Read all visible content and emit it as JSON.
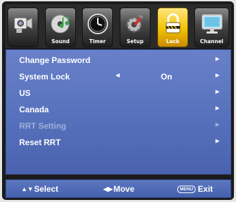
{
  "tabs": [
    {
      "label": "",
      "icon": "camcorder-icon",
      "active": false
    },
    {
      "label": "Sound",
      "icon": "music-cd-icon",
      "active": false
    },
    {
      "label": "Timer",
      "icon": "clock-icon",
      "active": false
    },
    {
      "label": "Setup",
      "icon": "gear-setup-icon",
      "active": false
    },
    {
      "label": "Lock",
      "icon": "padlock-icon",
      "active": true
    },
    {
      "label": "Channel",
      "icon": "monitor-icon",
      "active": false
    }
  ],
  "menu": {
    "items": [
      {
        "label": "Change Password",
        "value": "",
        "disabled": false
      },
      {
        "label": "System Lock",
        "value": "On",
        "disabled": false
      },
      {
        "label": "US",
        "value": "",
        "disabled": false
      },
      {
        "label": "Canada",
        "value": "",
        "disabled": false
      },
      {
        "label": "RRT Setting",
        "value": "",
        "disabled": true
      },
      {
        "label": "Reset RRT",
        "value": "",
        "disabled": false
      }
    ]
  },
  "help": {
    "select_label": "Select",
    "move_label": "Move",
    "menu_key": "MENU",
    "exit_label": "Exit"
  },
  "colors": {
    "panel": "#5a74bf",
    "active_tab": "#f2c200",
    "text": "#ffffff",
    "disabled_text": "#9fb0da"
  }
}
